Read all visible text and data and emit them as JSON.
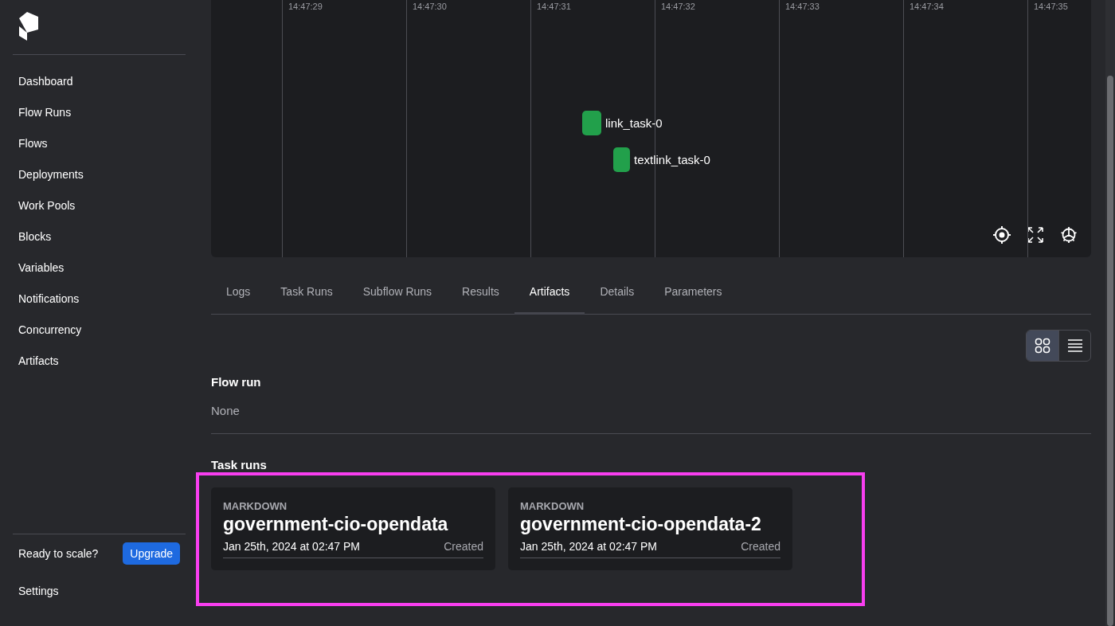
{
  "sidebar": {
    "items": [
      {
        "label": "Dashboard"
      },
      {
        "label": "Flow Runs"
      },
      {
        "label": "Flows"
      },
      {
        "label": "Deployments"
      },
      {
        "label": "Work Pools"
      },
      {
        "label": "Blocks"
      },
      {
        "label": "Variables"
      },
      {
        "label": "Notifications"
      },
      {
        "label": "Concurrency"
      },
      {
        "label": "Artifacts"
      }
    ],
    "upgrade_prompt": "Ready to scale?",
    "upgrade_button": "Upgrade",
    "settings": "Settings"
  },
  "timeline": {
    "ticks": [
      "14:47:29",
      "14:47:30",
      "14:47:31",
      "14:47:32",
      "14:47:33",
      "14:47:34",
      "14:47:35"
    ],
    "nodes": [
      {
        "label": "link_task-0"
      },
      {
        "label": "textlink_task-0"
      }
    ]
  },
  "tabs": [
    {
      "label": "Logs",
      "selected": false
    },
    {
      "label": "Task Runs",
      "selected": false
    },
    {
      "label": "Subflow Runs",
      "selected": false
    },
    {
      "label": "Results",
      "selected": false
    },
    {
      "label": "Artifacts",
      "selected": true
    },
    {
      "label": "Details",
      "selected": false
    },
    {
      "label": "Parameters",
      "selected": false
    }
  ],
  "view_toggle": [
    {
      "kind": "grid",
      "selected": true
    },
    {
      "kind": "list",
      "selected": false
    }
  ],
  "flow_run": {
    "heading": "Flow run",
    "value": "None"
  },
  "task_runs": {
    "heading": "Task runs",
    "artifacts": [
      {
        "type": "MARKDOWN",
        "key": "government-cio-opendata",
        "timestamp": "Jan 25th, 2024 at 02:47 PM",
        "status": "Created"
      },
      {
        "type": "MARKDOWN",
        "key": "government-cio-opendata-2",
        "timestamp": "Jan 25th, 2024 at 02:47 PM",
        "status": "Created"
      }
    ]
  }
}
